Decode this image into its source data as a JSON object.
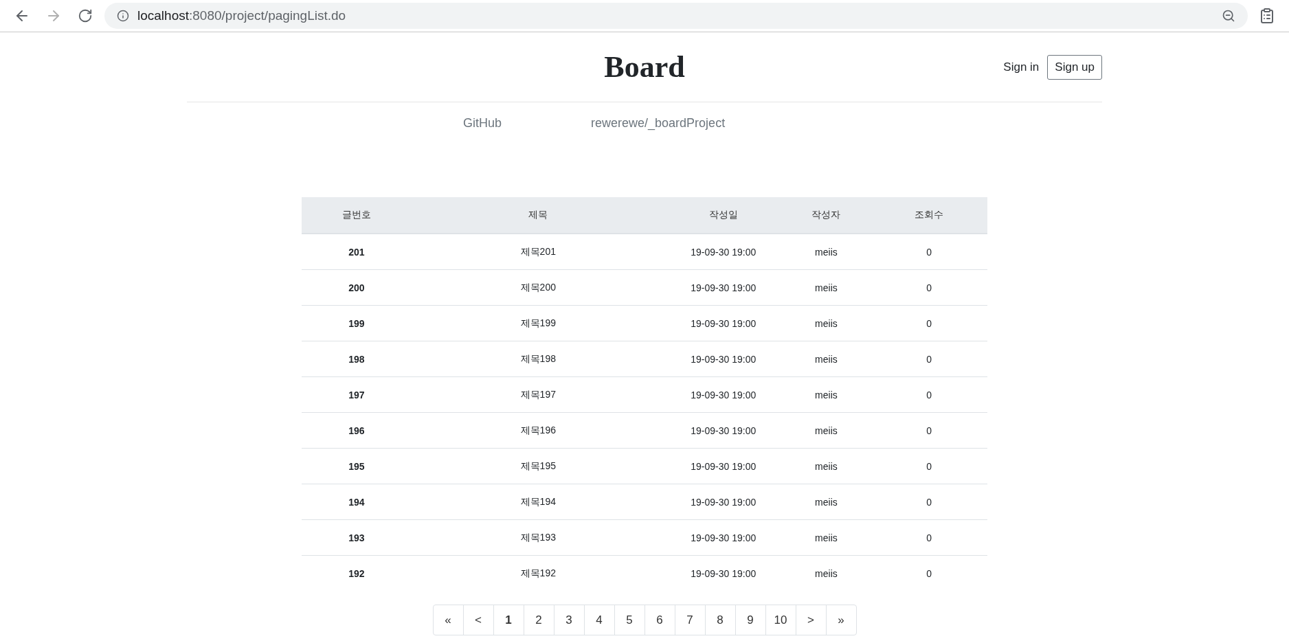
{
  "browser": {
    "url_host": "localhost",
    "url_path": ":8080/project/pagingList.do"
  },
  "header": {
    "title": "Board",
    "links": [
      {
        "label": "Sign in",
        "kind": "link"
      },
      {
        "label": "Sign up",
        "kind": "outline"
      }
    ]
  },
  "nav": [
    "GitHub",
    "rewerewe/_boardProject"
  ],
  "table": {
    "columns": [
      "글번호",
      "제목",
      "작성일",
      "작성자",
      "조회수"
    ],
    "rows": [
      [
        "201",
        "제목201",
        "19-09-30 19:00",
        "meiis",
        "0"
      ],
      [
        "200",
        "제목200",
        "19-09-30 19:00",
        "meiis",
        "0"
      ],
      [
        "199",
        "제목199",
        "19-09-30 19:00",
        "meiis",
        "0"
      ],
      [
        "198",
        "제목198",
        "19-09-30 19:00",
        "meiis",
        "0"
      ],
      [
        "197",
        "제목197",
        "19-09-30 19:00",
        "meiis",
        "0"
      ],
      [
        "196",
        "제목196",
        "19-09-30 19:00",
        "meiis",
        "0"
      ],
      [
        "195",
        "제목195",
        "19-09-30 19:00",
        "meiis",
        "0"
      ],
      [
        "194",
        "제목194",
        "19-09-30 19:00",
        "meiis",
        "0"
      ],
      [
        "193",
        "제목193",
        "19-09-30 19:00",
        "meiis",
        "0"
      ],
      [
        "192",
        "제목192",
        "19-09-30 19:00",
        "meiis",
        "0"
      ]
    ]
  },
  "pagination": [
    {
      "label": "«",
      "selected": false
    },
    {
      "label": "<",
      "selected": false
    },
    {
      "label": "1",
      "selected": true
    },
    {
      "label": "2",
      "selected": false
    },
    {
      "label": "3",
      "selected": false
    },
    {
      "label": "4",
      "selected": false
    },
    {
      "label": "5",
      "selected": false
    },
    {
      "label": "6",
      "selected": false
    },
    {
      "label": "7",
      "selected": false
    },
    {
      "label": "8",
      "selected": false
    },
    {
      "label": "9",
      "selected": false
    },
    {
      "label": "10",
      "selected": false
    },
    {
      "label": ">",
      "selected": false
    },
    {
      "label": "»",
      "selected": false
    }
  ]
}
